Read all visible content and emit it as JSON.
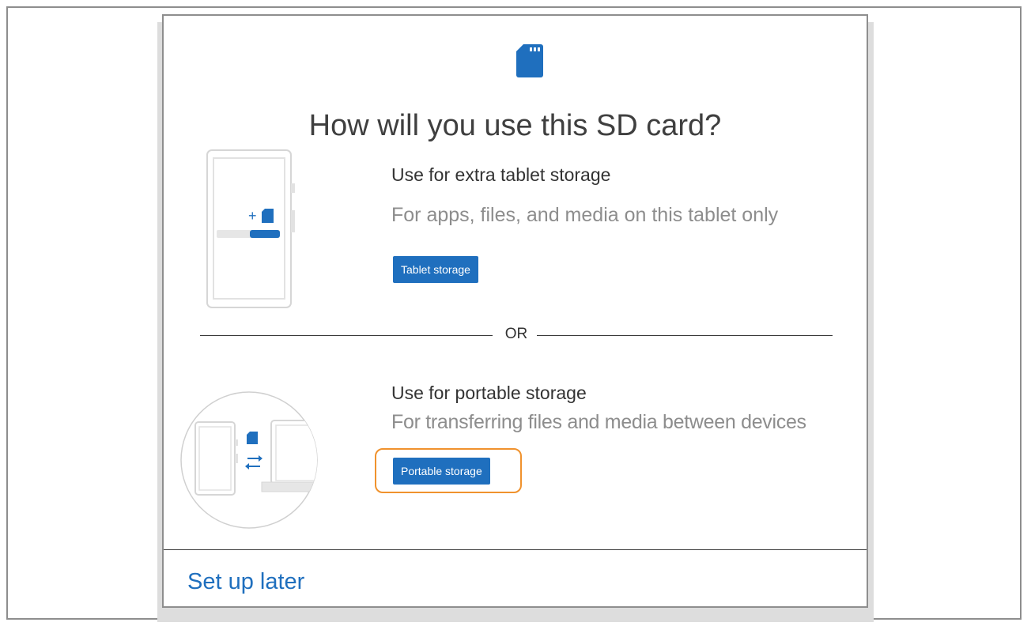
{
  "dialog": {
    "title": "How will you use this SD card?",
    "icon": "sd-card-icon"
  },
  "tablet_option": {
    "title": "Use for extra tablet storage",
    "description": "For apps, files, and media on this tablet only",
    "button_label": "Tablet storage",
    "illustration_plus": "+",
    "illustration_icons": [
      "tablet-icon",
      "sd-card-icon",
      "storage-bar"
    ]
  },
  "divider": {
    "label": "OR"
  },
  "portable_option": {
    "title": "Use for portable storage",
    "description": "For transferring files and media between devices",
    "button_label": "Portable storage",
    "highlighted": true,
    "illustration_icons": [
      "tablet-icon",
      "sd-card-icon",
      "transfer-arrows-icon",
      "laptop-icon"
    ]
  },
  "footer": {
    "set_up_later_label": "Set up later"
  },
  "colors": {
    "accent": "#1f6fbe",
    "highlight": "#f0922d",
    "title_text": "#3f3f3f",
    "muted_text": "#8d8d8d"
  }
}
